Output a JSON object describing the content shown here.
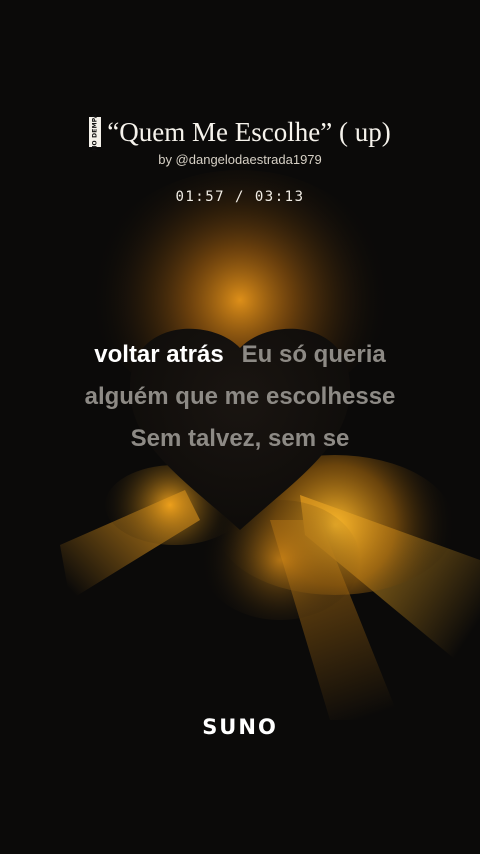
{
  "song": {
    "badge_text": "NO DEMPA",
    "title": "“Quem Me Escolhe” ( up)",
    "artist": "by @dangelodaestrada1979",
    "time": "01:57 / 03:13"
  },
  "lyrics": {
    "line1_sung": "voltar atrás",
    "line1_upcoming": "Eu só queria",
    "line2": "alguém que me escolhesse",
    "line3": "Sem talvez, sem se"
  },
  "brand": {
    "logo_text": "SUNO"
  },
  "colors": {
    "background": "#0b0a09",
    "glow": "#f2a21a",
    "sung_text": "#ffffff",
    "upcoming_text": "#8d8a85"
  }
}
